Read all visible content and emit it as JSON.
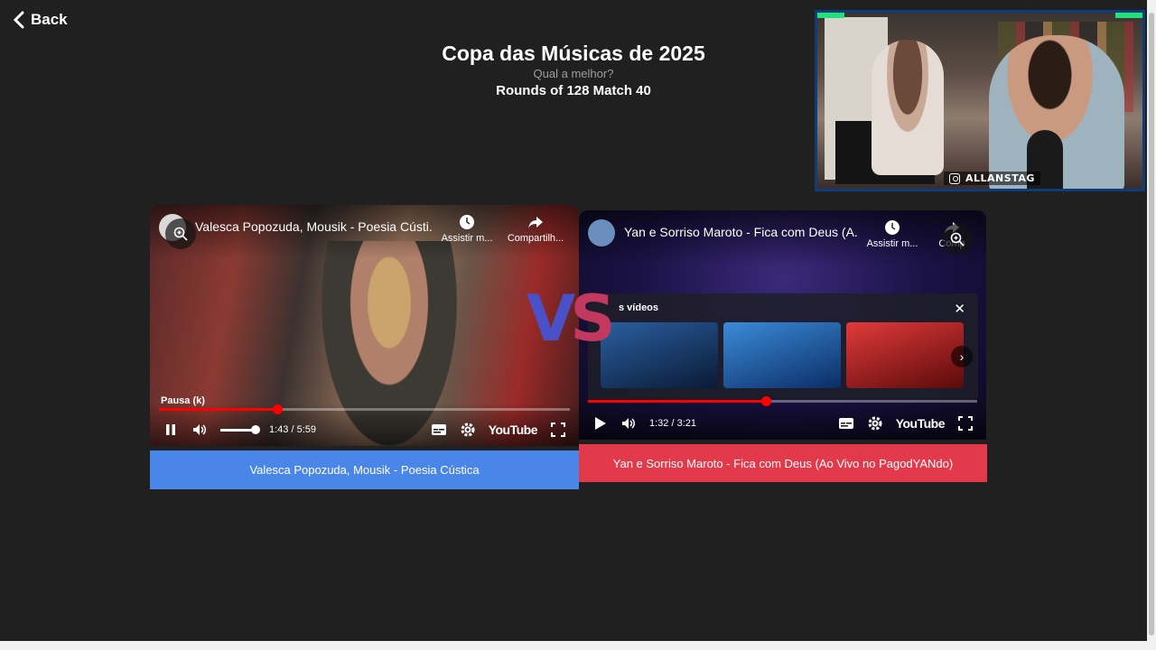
{
  "header": {
    "back_label": "Back",
    "title": "Copa das Músicas de 2025",
    "subtitle": "Qual a melhor?",
    "round": "Rounds of 128 Match 40"
  },
  "webcam": {
    "handle": "ALLANSTAG"
  },
  "player_left": {
    "title": "Valesca Popozuda, Mousik - Poesia Cústi...",
    "watch_later": "Assistir m...",
    "share": "Compartilh...",
    "tooltip": "Pausa (k)",
    "time": "1:43 / 5:59",
    "progress": 0.287,
    "brand": "YouTube"
  },
  "player_right": {
    "title": "Yan e Sorriso Maroto - Fica com Deus (A...",
    "watch_later": "Assistir m...",
    "share": "Comp",
    "more_videos": "s vídeos",
    "time": "1:32 / 3:21",
    "progress": 0.458,
    "brand": "YouTube"
  },
  "vs": {
    "v": "V",
    "s": "S"
  },
  "vote_left": "Valesca Popozuda, Mousik - Poesia Cústica",
  "vote_right": "Yan e Sorriso Maroto - Fica com Deus (Ao Vivo no PagodYANdo)",
  "colors": {
    "vote_left": "#4a86e8",
    "vote_right": "#e23a4a",
    "progress": "#ff0000"
  }
}
